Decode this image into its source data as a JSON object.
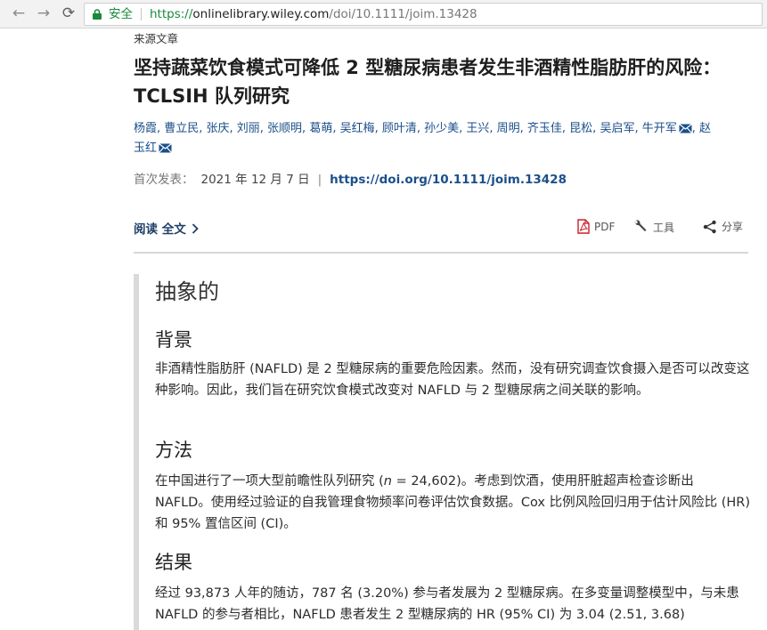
{
  "browser": {
    "back_icon": "←",
    "forward_icon": "→",
    "reload_icon": "⟳",
    "secure_label": "安全",
    "url_scheme": "https://",
    "url_host": "onlinelibrary.wiley.com",
    "url_path": "/doi/10.1111/joim.13428"
  },
  "article": {
    "type": "来源文章",
    "title": "坚持蔬菜饮食模式可降低 2 型糖尿病患者发生非酒精性脂肪肝的风险：TCLSIH 队列研究",
    "authors_main": "杨霞, 曹立民, 张庆, 刘丽, 张顺明, 葛萌, 吴红梅, 顾叶清, 孙少美, 王兴, 周明, 齐玉佳, 昆松, 吴启军, 牛开军",
    "authors_tail": ", 赵",
    "authors_line2": "玉红",
    "published_label": "首次发表：",
    "published_date": "2021 年 12 月 7 日",
    "doi_sep": "|",
    "doi": "https://doi.org/10.1111/joim.13428"
  },
  "actions": {
    "read_full": "阅读 全文",
    "pdf": "PDF",
    "tools": "工具",
    "share": "分享"
  },
  "abstract": {
    "heading": "抽象的",
    "background_heading": "背景",
    "background_text": "非酒精性脂肪肝 (NAFLD) 是 2 型糖尿病的重要危险因素。然而，没有研究调查饮食摄入是否可以改变这种影响。因此，我们旨在研究饮食模式改变对 NAFLD 与 2 型糖尿病之间关联的影响。",
    "methods_heading": "方法",
    "methods_text_a": "在中国进行了一项大型前瞻性队列研究 (",
    "methods_n": "n",
    "methods_text_b": " = 24,602)。考虑到饮酒，使用肝脏超声检查诊断出 NAFLD。使用经过验证的自我管理食物频率问卷评估饮食数据。Cox 比例风险回归用于估计风险比 (HR) 和 95% 置信区间 (CI)。",
    "results_heading": "结果",
    "results_text": "经过 93,873 人年的随访，787 名 (3.20%) 参与者发展为 2 型糖尿病。在多变量调整模型中，与未患 NAFLD 的参与者相比，NAFLD 患者发生 2 型糖尿病的 HR (95% CI) 为 3.04 (2.51, 3.68)"
  },
  "colors": {
    "link": "#1b4f8a",
    "secure_green": "#1a8a3a",
    "pdf_red": "#c8202a"
  }
}
